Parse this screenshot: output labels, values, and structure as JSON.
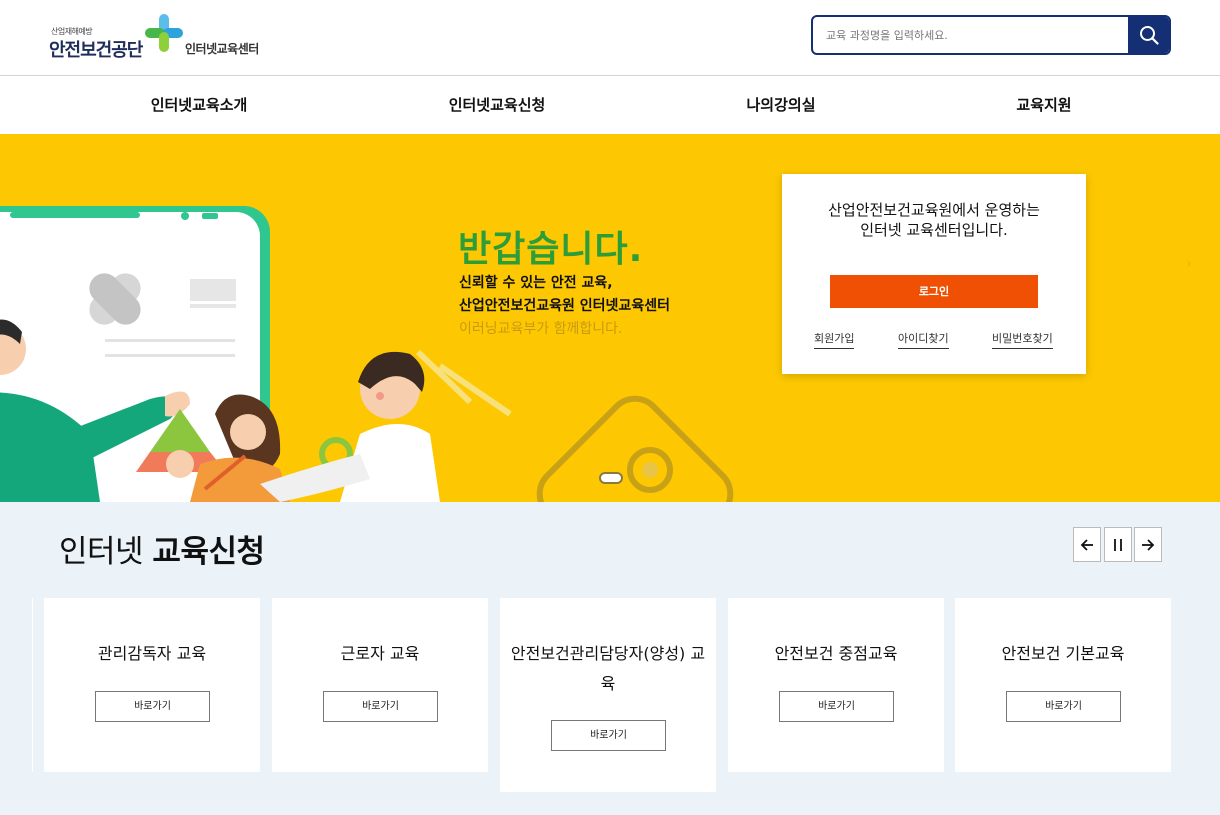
{
  "header": {
    "logo_small": "산업재해예방",
    "logo_main": "안전보건공단",
    "logo_sub": "인터넷교육센터",
    "search_placeholder": "교육 과정명을 입력하세요."
  },
  "nav": {
    "items": [
      {
        "label": "인터넷교육소개"
      },
      {
        "label": "인터넷교육신청"
      },
      {
        "label": "나의강의실"
      },
      {
        "label": "교육지원"
      }
    ]
  },
  "hero": {
    "title": "반갑습니다.",
    "line1": "신뢰할 수 있는 안전 교육,",
    "line2": "산업안전보건교육원 인터넷교육센터",
    "line3": "이러닝교육부가 함께합니다.",
    "login_card": {
      "text_line1": "산업안전보건교육원에서 운영하는",
      "text_line2": "인터넷 교육센터입니다.",
      "login_label": "로그인",
      "signup_label": "회원가입",
      "find_id_label": "아이디찾기",
      "find_pw_label": "비밀번호찾기"
    }
  },
  "courses": {
    "title_normal": "인터넷 ",
    "title_bold": "교육신청",
    "cards": [
      {
        "title": "관리감독자 교육",
        "button": "바로가기"
      },
      {
        "title": "근로자 교육",
        "button": "바로가기"
      },
      {
        "title": "안전보건관리담당자(양성) 교육",
        "button": "바로가기"
      },
      {
        "title": "안전보건 중점교육",
        "button": "바로가기"
      },
      {
        "title": "안전보건 기본교육",
        "button": "바로가기"
      }
    ]
  },
  "colors": {
    "brand_navy": "#142f73",
    "hero_yellow": "#fdc801",
    "hero_green": "#2d9d3a",
    "login_orange": "#f05003",
    "section_bg": "#ebf3f9"
  }
}
